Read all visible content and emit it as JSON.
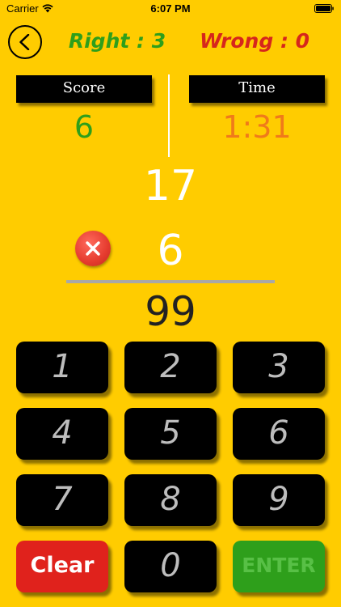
{
  "status_bar": {
    "carrier": "Carrier",
    "time": "6:07 PM"
  },
  "header": {
    "right": "Right : 3",
    "wrong": "Wrong : 0"
  },
  "panels": {
    "score_label": "Score",
    "score_value": "6",
    "time_label": "Time",
    "time_value": "1:31"
  },
  "problem": {
    "top_operand": "17",
    "bottom_operand": "6",
    "answer": "99"
  },
  "keypad": {
    "keys": [
      "1",
      "2",
      "3",
      "4",
      "5",
      "6",
      "7",
      "8",
      "9"
    ],
    "clear": "Clear",
    "zero": "0",
    "enter": "ENTER"
  },
  "colors": {
    "background": "#FFCC00",
    "right": "#2E9F1B",
    "wrong": "#D6261C",
    "time": "#F07A1A",
    "key": "#000000",
    "clear": "#E0221C",
    "enter": "#2E9F1B"
  },
  "icons": {
    "back": "chevron-left-icon",
    "wrong_mark": "close-icon",
    "wifi": "wifi-icon",
    "battery": "battery-icon"
  }
}
